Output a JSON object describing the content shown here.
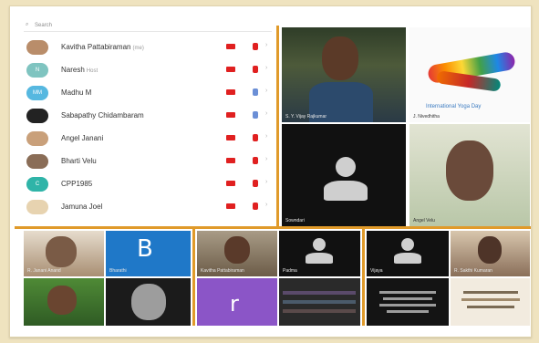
{
  "search": {
    "placeholder": "Search"
  },
  "participants": [
    {
      "name": "Kavitha Pattabiraman",
      "tag": "(me)",
      "avatar_color": "#b98d6a",
      "avatar_text": "",
      "cam_color": "#e02020"
    },
    {
      "name": "Naresh",
      "tag": "Host",
      "avatar_color": "#7fc4c0",
      "avatar_text": "N",
      "cam_color": "#e02020"
    },
    {
      "name": "Madhu M",
      "tag": "",
      "avatar_color": "#56b8e0",
      "avatar_text": "MM",
      "cam_color": "#6b8fd6"
    },
    {
      "name": "Sabapathy Chidambaram",
      "tag": "",
      "avatar_color": "#222222",
      "avatar_text": "",
      "cam_color": "#6b8fd6"
    },
    {
      "name": "Angel Janani",
      "tag": "",
      "avatar_color": "#c9a07a",
      "avatar_text": "",
      "cam_color": "#e02020"
    },
    {
      "name": "Bharti Velu",
      "tag": "",
      "avatar_color": "#8a6d57",
      "avatar_text": "",
      "cam_color": "#e02020"
    },
    {
      "name": "CPP1985",
      "tag": "",
      "avatar_color": "#2fb4a8",
      "avatar_text": "C",
      "cam_color": "#e02020"
    },
    {
      "name": "Jamuna Joel",
      "tag": "",
      "avatar_color": "#e7d3b0",
      "avatar_text": "",
      "cam_color": "#e02020"
    }
  ],
  "video_top": [
    {
      "label": "S. Y. Vijay Rajkumar"
    },
    {
      "label": "J. Nivedhitha"
    },
    {
      "label": "Sowndari"
    },
    {
      "label": "Angel Velu"
    }
  ],
  "video_bottom": {
    "group_a": [
      {
        "label": "R. Janani Anand"
      },
      {
        "label": "Bharathi",
        "letter": "B",
        "color": "#1f78c8"
      },
      {
        "label": ""
      },
      {
        "label": ""
      }
    ],
    "group_b": [
      {
        "label": "Kavitha Pattabiraman"
      },
      {
        "label": "Padma"
      },
      {
        "label": "",
        "letter": "r",
        "color": "#8b55c7"
      },
      {
        "label": ""
      }
    ],
    "group_c": [
      {
        "label": "Vijaya"
      },
      {
        "label": "R. Sakthi Kumaran"
      },
      {
        "label": ""
      },
      {
        "label": ""
      }
    ]
  },
  "event_banner": "International Yoga Day"
}
